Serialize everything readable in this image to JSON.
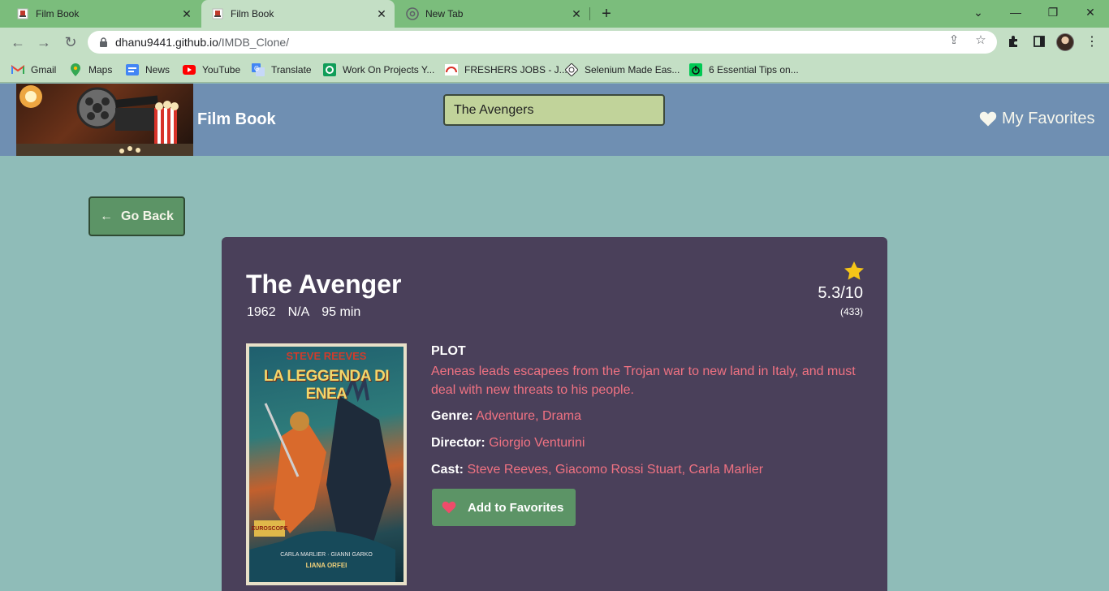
{
  "browser": {
    "tabs": [
      {
        "title": "Film Book",
        "active": false
      },
      {
        "title": "Film Book",
        "active": true
      },
      {
        "title": "New Tab",
        "active": false
      }
    ],
    "url_host": "dhanu9441.github.io",
    "url_path": "/IMDB_Clone/",
    "bookmarks": [
      "Gmail",
      "Maps",
      "News",
      "YouTube",
      "Translate",
      "Work On Projects Y...",
      "FRESHERS JOBS - J...",
      "Selenium Made Eas...",
      "6 Essential Tips on..."
    ]
  },
  "header": {
    "brand": "Film Book",
    "search_value": "The Avengers",
    "favorites_label": "My Favorites"
  },
  "page": {
    "go_back_label": "Go Back"
  },
  "movie": {
    "title": "The Avenger",
    "year": "1962",
    "rated": "N/A",
    "runtime": "95 min",
    "rating": "5.3/10",
    "votes": "(433)",
    "plot_label": "PLOT",
    "plot": "Aeneas leads escapees from the Trojan war to new land in Italy, and must deal with new threats to his people.",
    "genre_label": "Genre:",
    "genre": "Adventure, Drama",
    "director_label": "Director:",
    "director": "Giorgio Venturini",
    "cast_label": "Cast:",
    "cast": "Steve Reeves, Giacomo Rossi Stuart, Carla Marlier",
    "add_favorites_label": "Add to Favorites",
    "poster": {
      "top_text": "STEVE REEVES",
      "title_text": "LA LEGGENDA DI ENEA",
      "badge_text": "EUROSCOPE",
      "cast_text": "CARLA MARLIER · GIANNI GARKO",
      "star_text": "LIANA ORFEI"
    }
  },
  "colors": {
    "header_bg": "#6f8fb2",
    "page_bg": "#8fbcb8",
    "card_bg": "#4a405a",
    "accent_green": "#5c9466",
    "value_pink": "#f07282",
    "star_yellow": "#f5c518"
  }
}
